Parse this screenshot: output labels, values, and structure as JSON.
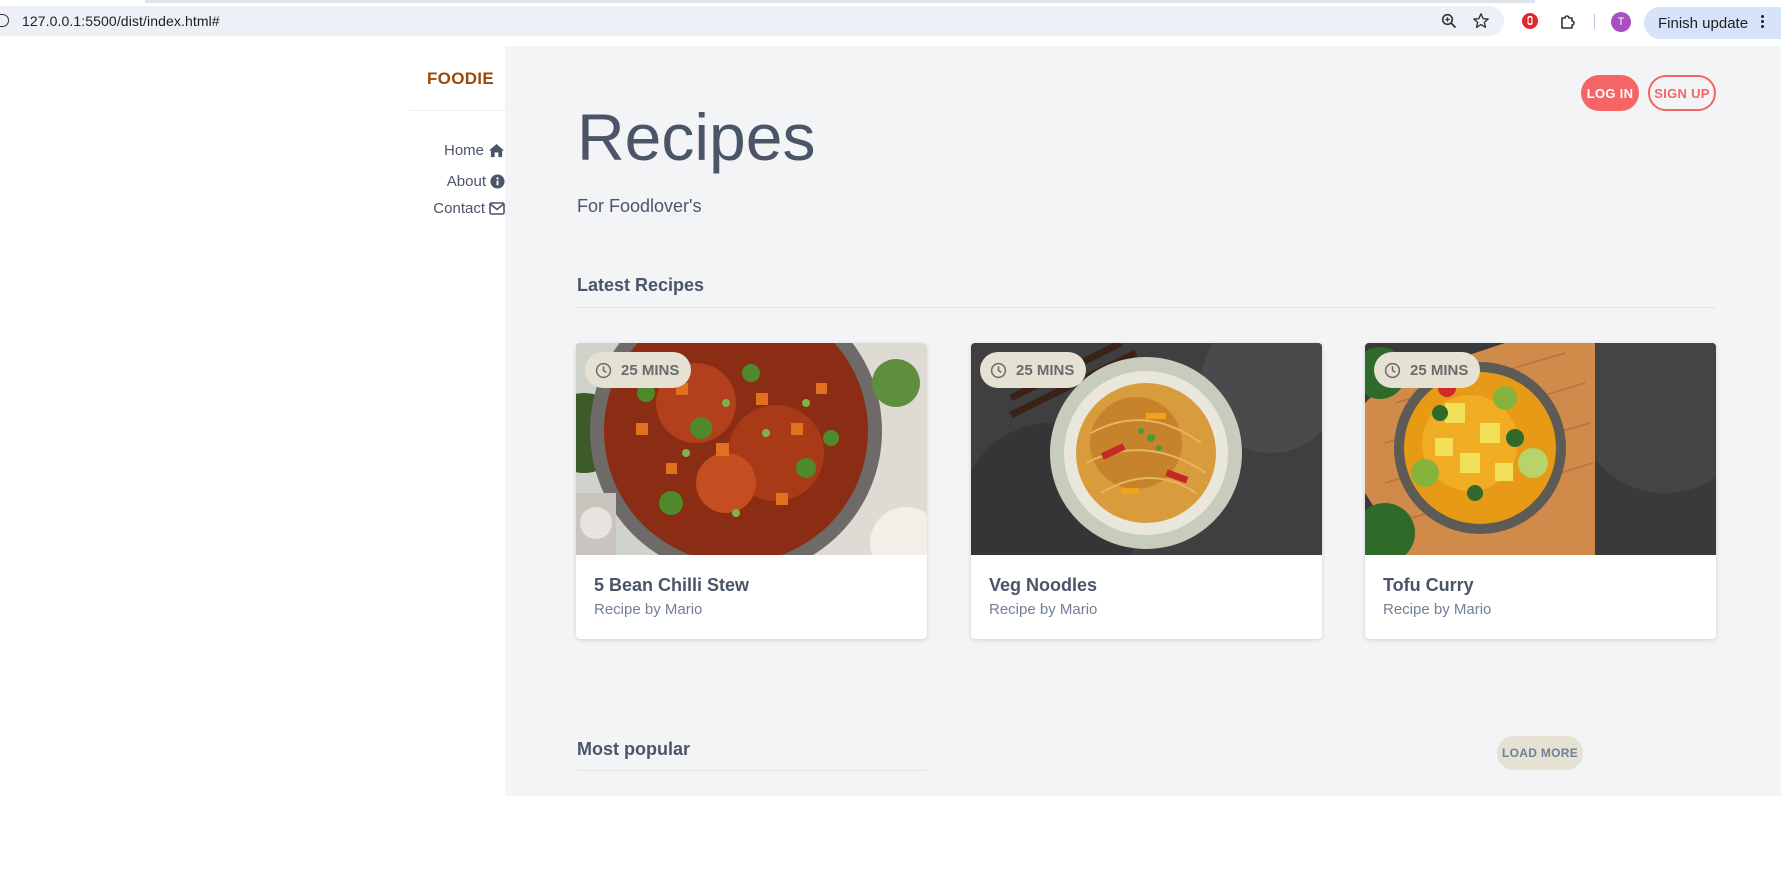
{
  "browser": {
    "url": "127.0.0.1:5500/dist/index.html#",
    "profile_initial": "T",
    "finish_update_label": "Finish update",
    "icons": [
      "site-info-icon",
      "zoom-icon",
      "bookmark-star-icon",
      "extension-red-icon",
      "extensions-puzzle-icon",
      "menu-dots-icon"
    ]
  },
  "sidebar": {
    "brand": "FOODIE",
    "items": [
      {
        "label": "Home",
        "icon": "home-icon"
      },
      {
        "label": "About",
        "icon": "info-icon"
      },
      {
        "label": "Contact",
        "icon": "envelope-icon"
      }
    ]
  },
  "header": {
    "login_label": "LOG IN",
    "signup_label": "SIGN UP",
    "title": "Recipes",
    "subtitle": "For Foodlover's"
  },
  "latest": {
    "heading": "Latest Recipes",
    "cards": [
      {
        "time": "25 MINS",
        "name": "5 Bean Chilli Stew",
        "author": "Recipe by Mario",
        "image": "bean-chilli-stew-photo"
      },
      {
        "time": "25 MINS",
        "name": "Veg Noodles",
        "author": "Recipe by Mario",
        "image": "veg-noodles-photo"
      },
      {
        "time": "25 MINS",
        "name": "Tofu Curry",
        "author": "Recipe by Mario",
        "image": "tofu-curry-photo"
      }
    ]
  },
  "popular": {
    "heading": "Most popular",
    "load_more_label": "LOAD MORE"
  },
  "colors": {
    "brand": "#9a4a0a",
    "accent": "#f56565",
    "text": "#4a5568",
    "muted": "#718096",
    "main_bg": "#f3f4f6",
    "badge_bg": "#e5e1d3"
  }
}
